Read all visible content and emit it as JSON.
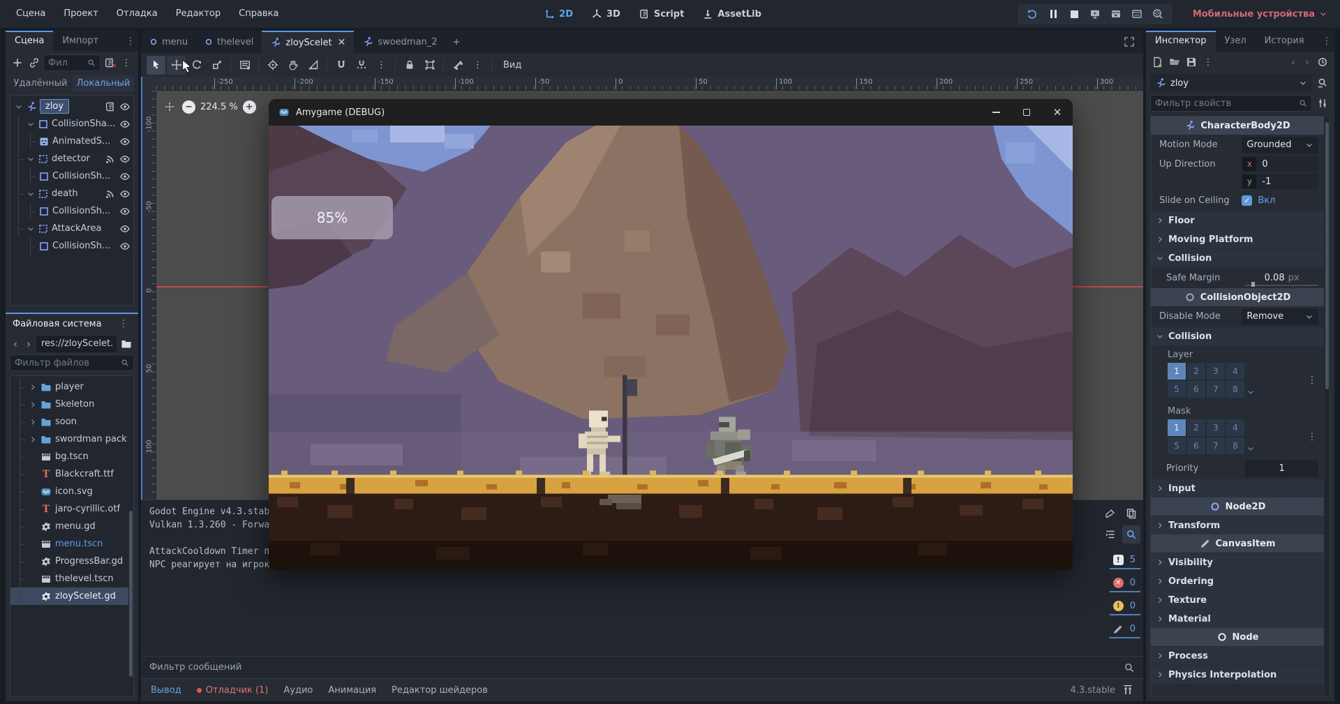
{
  "menubar": {
    "menus": [
      "Сцена",
      "Проект",
      "Отладка",
      "Редактор",
      "Справка"
    ],
    "editors": [
      "2D",
      "3D",
      "Script",
      "AssetLib"
    ],
    "platform": "Мобильные устройства"
  },
  "scene_dock": {
    "tabs": [
      "Сцена",
      "Импорт"
    ],
    "filter_placeholder": "Фил",
    "mode_tabs": [
      "Удалённый",
      "Локальный"
    ],
    "tree": [
      "zloy",
      "CollisionSha...",
      "AnimatedS...",
      "detector",
      "CollisionSh...",
      "death",
      "CollisionSh...",
      "AttackArea",
      "CollisionSh..."
    ]
  },
  "filesystem": {
    "title": "Файловая система",
    "path": "res://zloyScelet.",
    "filter_placeholder": "Фильтр файлов",
    "items": [
      "player",
      "Skeleton",
      "soon",
      "swordman pack",
      "bg.tscn",
      "Blackcraft.ttf",
      "icon.svg",
      "jaro-cyrillic.otf",
      "menu.gd",
      "menu.tscn",
      "ProgressBar.gd",
      "thelevel.tscn",
      "zloyScelet.gd"
    ]
  },
  "viewport": {
    "tabs": [
      "menu",
      "thelevel",
      "zloyScelet",
      "swoedman_2"
    ],
    "view_menu": "Вид",
    "zoom": "224.5 %",
    "ruler_top": [
      "-250",
      "-200",
      "-150",
      "-100",
      "-50",
      "0",
      "50",
      "100",
      "150",
      "200",
      "250",
      "300"
    ],
    "ruler_left": [
      "-100",
      "-50",
      "0",
      "50",
      "100"
    ]
  },
  "game": {
    "title": "Amygame (DEBUG)",
    "progress": "85%"
  },
  "output": {
    "lines": [
      "Godot Engine v4.3.stab",
      "Vulkan 1.3.260 - Forwa",
      "AttackCooldown Timer п",
      "NPC реагирует на игрок"
    ],
    "filter_placeholder": "Фильтр сообщений",
    "counters": [
      "5",
      "0",
      "0",
      "0"
    ]
  },
  "bottom_bar": {
    "items": [
      "Вывод",
      "Отладчик (1)",
      "Аудио",
      "Анимация",
      "Редактор шейдеров"
    ],
    "version": "4.3.stable"
  },
  "inspector": {
    "tabs": [
      "Инспектор",
      "Узел",
      "История"
    ],
    "node_name": "zloy",
    "filter_placeholder": "Фильтр свойств",
    "categories": [
      "CharacterBody2D",
      "CollisionObject2D",
      "Node2D",
      "CanvasItem",
      "Node"
    ],
    "groups": [
      "Floor",
      "Moving Platform",
      "Collision",
      "Input",
      "Transform",
      "Visibility",
      "Ordering",
      "Texture",
      "Material",
      "Process",
      "Physics Interpolation"
    ],
    "bits": [
      "1",
      "2",
      "3",
      "4",
      "5",
      "6",
      "7",
      "8"
    ],
    "props": {
      "motion_mode": "Motion Mode",
      "motion_mode_value": "Grounded",
      "up_direction": "Up Direction",
      "up_x_label": "x",
      "up_x": "0",
      "up_y_label": "y",
      "up_y": "-1",
      "slide_on_ceiling": "Slide on Ceiling",
      "slide_on": "Вкл",
      "safe_margin": "Safe Margin",
      "safe_margin_value": "0.08",
      "safe_margin_unit": "px",
      "disable_mode": "Disable Mode",
      "disable_mode_value": "Remove",
      "layer": "Layer",
      "mask": "Mask",
      "priority": "Priority",
      "priority_value": "1"
    }
  }
}
